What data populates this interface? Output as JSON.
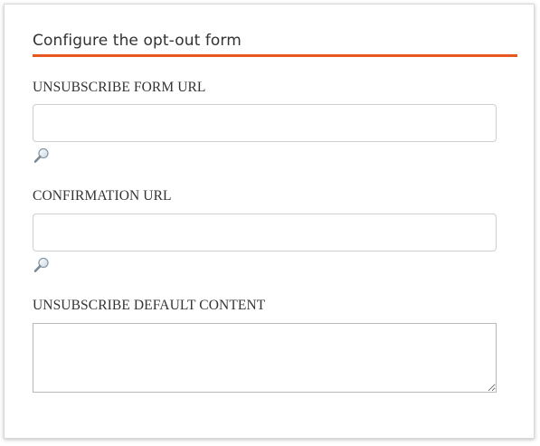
{
  "section": {
    "title": "Configure the opt-out form",
    "accent_color": "#e8571e"
  },
  "fields": {
    "unsubscribe_form_url": {
      "label": "UNSUBSCRIBE FORM URL",
      "value": "",
      "lookup_icon": "magnifier-icon"
    },
    "confirmation_url": {
      "label": "CONFIRMATION URL",
      "value": "",
      "lookup_icon": "magnifier-icon"
    },
    "unsubscribe_default_content": {
      "label": "UNSUBSCRIBE DEFAULT CONTENT",
      "value": ""
    }
  }
}
